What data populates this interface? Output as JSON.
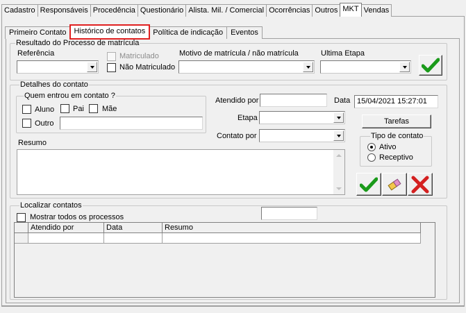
{
  "main_tabs": [
    "Cadastro",
    "Responsáveis",
    "Procedência",
    "Questionário",
    "Alista. Mil. / Comercial",
    "Ocorrências",
    "Outros",
    "MKT",
    "Vendas"
  ],
  "active_main_tab": "MKT",
  "sub_tabs": [
    "Primeiro Contato",
    "Histórico de contatos",
    "Política de indicação",
    "Eventos"
  ],
  "active_sub_tab": "Histórico de contatos",
  "highlight_color": "#e02020",
  "resultado": {
    "group_title": "Resultado do Processo de matrícula",
    "referencia_label": "Referência",
    "referencia_value": "",
    "matriculado_label": "Matriculado",
    "nao_matriculado_label": "Não Matriculado",
    "motivo_label": "Motivo de matrícula / não matrícula",
    "motivo_value": "",
    "ultima_etapa_label": "Ultima Etapa",
    "ultima_etapa_value": ""
  },
  "detalhes": {
    "group_title": "Detalhes do contato",
    "quem_title": "Quem  entrou em contato ?",
    "aluno_label": "Aluno",
    "pai_label": "Pai",
    "mae_label": "Mãe",
    "outro_label": "Outro",
    "outro_value": "",
    "atendido_label": "Atendido por",
    "atendido_value": "",
    "data_label": "Data",
    "data_value": "15/04/2021 15:27:01",
    "etapa_label": "Etapa",
    "etapa_value": "",
    "contato_por_label": "Contato por",
    "contato_por_value": "",
    "tarefas_label": "Tarefas",
    "tipo_title": "Tipo de contato",
    "ativo_label": "Ativo",
    "receptivo_label": "Receptivo",
    "tipo_selected": "Ativo",
    "resumo_label": "Resumo",
    "resumo_value": ""
  },
  "localizar": {
    "group_title": "Localizar contatos",
    "mostrar_label": "Mostrar todos os processos",
    "search_value": "",
    "columns": [
      "Atendido por",
      "Data",
      "Resumo"
    ]
  },
  "icons": {
    "confirm": "check-icon",
    "clear": "eraser-icon",
    "cancel": "x-icon"
  },
  "colors": {
    "check_green": "#1a9a1a",
    "cancel_red": "#d42020"
  }
}
